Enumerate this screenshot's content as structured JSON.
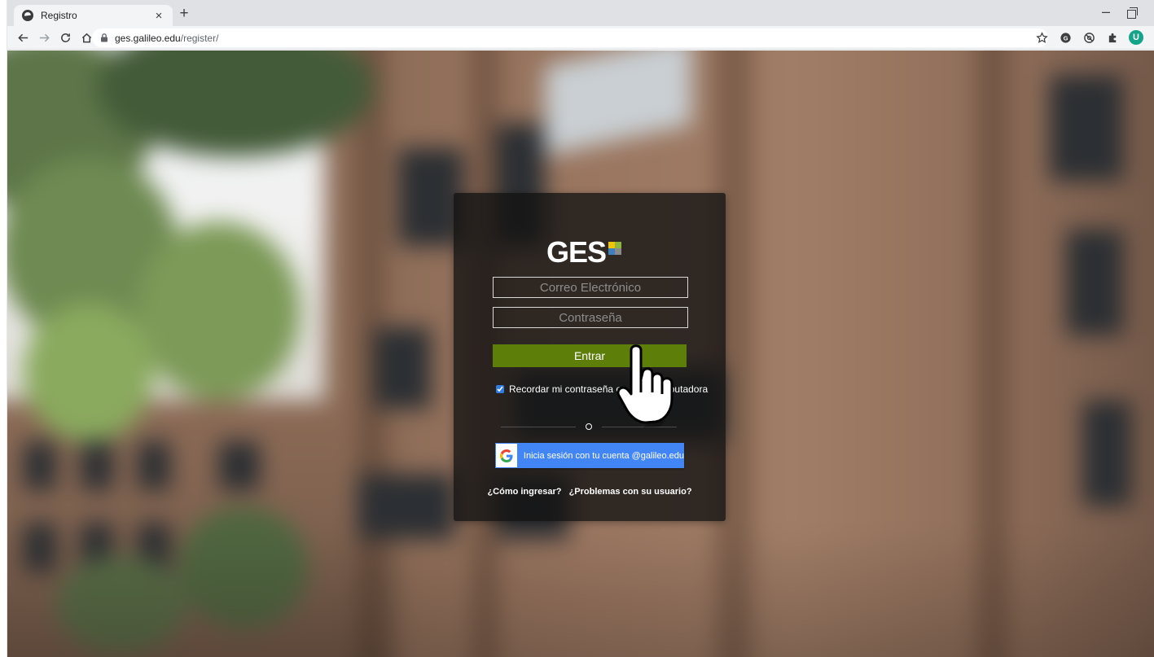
{
  "browser": {
    "tab_title": "Registro",
    "tab_close": "×",
    "new_tab": "+",
    "minimize": "–",
    "url_host": "ges.galileo.edu",
    "url_path": "/register/",
    "profile_initial": "U"
  },
  "login": {
    "logo_text": "GES",
    "logo_colors": [
      "#f2c500",
      "#8cb63c",
      "#3d7fc0",
      "#8a8a8a"
    ],
    "email_placeholder": "Correo Electrónico",
    "password_placeholder": "Contraseña",
    "submit_label": "Entrar",
    "submit_color": "#5e7e0a",
    "remember_label": "Recordar mi contraseña en esta computadora",
    "remember_checked": true,
    "google_button_label": "Inicia sesión con tu cuenta @galileo.edu",
    "google_button_color": "#4285f4",
    "help_link": "¿Cómo ingresar?",
    "problems_link": "¿Problemas con su usuario?"
  }
}
